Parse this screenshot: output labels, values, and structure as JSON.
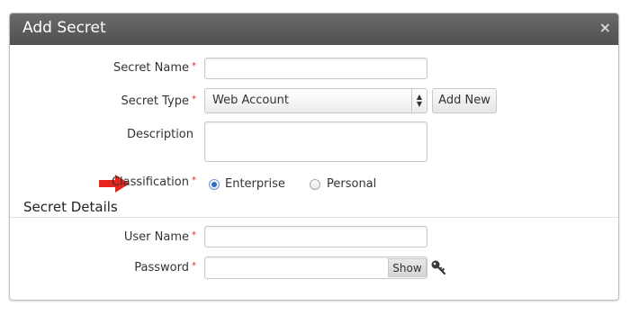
{
  "dialog": {
    "title": "Add Secret",
    "close_icon": "×"
  },
  "form": {
    "secret_name_label": "Secret Name",
    "secret_name_value": "",
    "secret_type_label": "Secret Type",
    "secret_type_value": "Web Account",
    "add_new_label": "Add New",
    "description_label": "Description",
    "description_value": "",
    "classification_label": "Classification",
    "classification_options": [
      "Enterprise",
      "Personal"
    ],
    "classification_selected": "Enterprise",
    "required_mark": "*"
  },
  "details": {
    "section_title": "Secret Details",
    "user_name_label": "User Name",
    "user_name_value": "",
    "password_label": "Password",
    "password_value": "",
    "show_label": "Show"
  },
  "colors": {
    "required": "#e0242a",
    "arrow": "#e8251d",
    "radio_selected": "#2f6fc2",
    "title_bar": "#595959"
  },
  "icons": {
    "pointer": "red-arrow-icon",
    "generate_password": "key-icon",
    "close": "close-icon"
  }
}
